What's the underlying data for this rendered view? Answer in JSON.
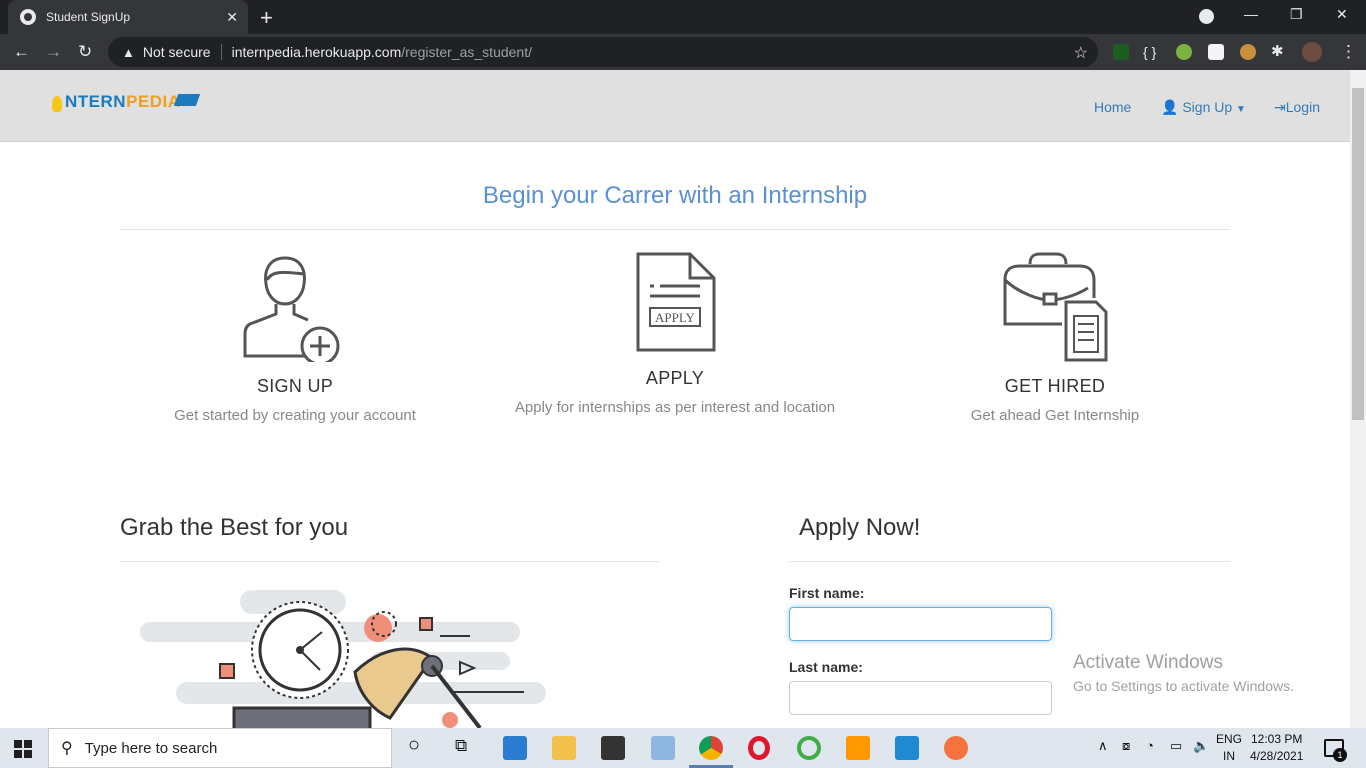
{
  "browser": {
    "tab_title": "Student SignUp",
    "security_label": "Not secure",
    "url_host": "internpedia.herokuapp.com",
    "url_path": "/register_as_student/"
  },
  "site": {
    "logo_part1": "NTERN",
    "logo_part2": "PEDIA",
    "nav": {
      "home": "Home",
      "signup": "Sign Up",
      "login": "Login"
    }
  },
  "hero": {
    "title": "Begin your Carrer with an Internship"
  },
  "features": [
    {
      "title": "SIGN UP",
      "desc": "Get started by creating your account",
      "icon": "user-add-icon"
    },
    {
      "title": "APPLY",
      "desc": "Apply for internships as per interest and location",
      "icon": "apply-document-icon",
      "doc_label": "APPLY"
    },
    {
      "title": "GET HIRED",
      "desc": "Get ahead Get Internship",
      "icon": "briefcase-icon"
    }
  ],
  "left_section": {
    "title": "Grab the Best for you"
  },
  "form": {
    "title": "Apply Now!",
    "first_name_label": "First name:",
    "first_name_value": "",
    "last_name_label": "Last name:",
    "last_name_value": ""
  },
  "watermark": {
    "line1": "Activate Windows",
    "line2": "Go to Settings to activate Windows."
  },
  "taskbar": {
    "search_placeholder": "Type here to search",
    "lang_line1": "ENG",
    "lang_line2": "IN",
    "time": "12:03 PM",
    "date": "4/28/2021",
    "notification_count": "1"
  },
  "colors": {
    "accent": "#337ab7",
    "hero_title": "#5b8fd6",
    "chrome_dark": "#202124",
    "chrome_mid": "#35363a"
  }
}
